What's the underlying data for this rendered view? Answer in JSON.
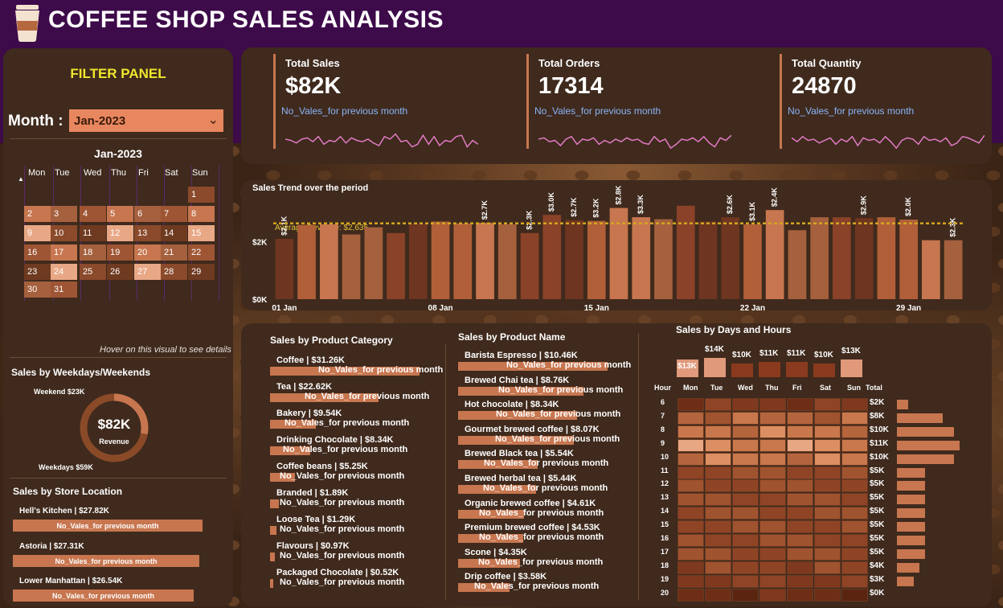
{
  "header": {
    "title": "COFFEE SHOP SALES ANALYSIS",
    "icon": "coffee-cup-icon"
  },
  "filter_panel": {
    "title": "FILTER PANEL",
    "month_label": "Month :",
    "month_value": "Jan-2023",
    "calendar": {
      "title": "Jan-2023",
      "weekdays": [
        "Mon",
        "Tue",
        "Wed",
        "Thu",
        "Fri",
        "Sat",
        "Sun"
      ],
      "weeks": [
        [
          "",
          "",
          "",
          "",
          "",
          "",
          "1"
        ],
        [
          "2",
          "3",
          "4",
          "5",
          "6",
          "7",
          "8"
        ],
        [
          "9",
          "10",
          "11",
          "12",
          "13",
          "14",
          "15"
        ],
        [
          "16",
          "17",
          "18",
          "19",
          "20",
          "21",
          "22"
        ],
        [
          "23",
          "24",
          "25",
          "26",
          "27",
          "28",
          "29"
        ],
        [
          "30",
          "31",
          "",
          "",
          "",
          "",
          ""
        ]
      ]
    },
    "hover_note": "Hover on this visual to see details"
  },
  "weekday_weekend": {
    "title": "Sales by Weekdays/Weekends",
    "weekend_label": "Weekend $23K",
    "weekdays_label": "Weekdays $59K",
    "center_value": "$82K",
    "center_caption": "Revenue",
    "weekend_share": 0.28
  },
  "store_location": {
    "title": "Sales by Store Location",
    "stores": [
      {
        "label": "Hell's Kitchen | $27.82K",
        "sub": "No_Vales_for previous month",
        "value": 27.82
      },
      {
        "label": "Astoria | $27.31K",
        "sub": "No_Vales_for previous month",
        "value": 27.31
      },
      {
        "label": "Lower Manhattan | $26.54K",
        "sub": "No_Vales_for previous month",
        "value": 26.54
      }
    ]
  },
  "kpis": [
    {
      "label": "Total Sales",
      "value": "$82K",
      "sub": "No_Vales_for previous month"
    },
    {
      "label": "Total Orders",
      "value": "17314",
      "sub": "No_Vales_for previous month"
    },
    {
      "label": "Total Quantity",
      "value": "24870",
      "sub": "No_Vales_for previous month"
    }
  ],
  "trend": {
    "title": "Sales Trend over the period",
    "avg_label": "Average Revenue: $2,635"
  },
  "product_category": {
    "title": "Sales by Product Category",
    "items": [
      {
        "label": "Coffee | $31.26K",
        "sub": "No_Vales_for previous month",
        "value": 31.26
      },
      {
        "label": "Tea | $22.62K",
        "sub": "No_Vales_for previous month",
        "value": 22.62
      },
      {
        "label": "Bakery | $9.54K",
        "sub": "No_Vales_for previous month",
        "value": 9.54
      },
      {
        "label": "Drinking Chocolate | $8.34K",
        "sub": "No_Vales_for previous month",
        "value": 8.34
      },
      {
        "label": "Coffee beans | $5.25K",
        "sub": "No_Vales_for previous month",
        "value": 5.25
      },
      {
        "label": "Branded | $1.89K",
        "sub": "No_Vales_for previous month",
        "value": 1.89
      },
      {
        "label": "Loose Tea | $1.29K",
        "sub": "No_Vales_for previous month",
        "value": 1.29
      },
      {
        "label": "Flavours | $0.97K",
        "sub": "No_Vales_for previous month",
        "value": 0.97
      },
      {
        "label": "Packaged Chocolate | $0.52K",
        "sub": "No_Vales_for previous month",
        "value": 0.52
      }
    ]
  },
  "product_name": {
    "title": "Sales by Product Name",
    "items": [
      {
        "label": "Barista Espresso | $10.46K",
        "sub": "No_Vales_for previous month",
        "value": 10.46
      },
      {
        "label": "Brewed Chai tea | $8.76K",
        "sub": "No_Vales_for previous month",
        "value": 8.76
      },
      {
        "label": "Hot chocolate | $8.34K",
        "sub": "No_Vales_for previous month",
        "value": 8.34
      },
      {
        "label": "Gourmet brewed coffee | $8.07K",
        "sub": "No_Vales_for previous month",
        "value": 8.07
      },
      {
        "label": "Brewed Black tea | $5.54K",
        "sub": "No_Vales_for previous month",
        "value": 5.54
      },
      {
        "label": "Brewed herbal tea | $5.44K",
        "sub": "No_Vales_for previous month",
        "value": 5.44
      },
      {
        "label": "Organic brewed coffee | $4.61K",
        "sub": "No_Vales_for previous month",
        "value": 4.61
      },
      {
        "label": "Premium brewed coffee | $4.53K",
        "sub": "No_Vales_for previous month",
        "value": 4.53
      },
      {
        "label": "Scone | $4.35K",
        "sub": "No_Vales_for previous month",
        "value": 4.35
      },
      {
        "label": "Drip coffee | $3.58K",
        "sub": "No_Vales_for previous month",
        "value": 3.58
      }
    ]
  },
  "heatmap": {
    "title": "Sales by Days and Hours",
    "hour_header": "Hour",
    "total_header": "Total",
    "days": [
      "Mon",
      "Tue",
      "Wed",
      "Thu",
      "Fri",
      "Sat",
      "Sun"
    ],
    "day_totals": [
      "$13K",
      "$14K",
      "$10K",
      "$11K",
      "$11K",
      "$10K",
      "$13K"
    ],
    "hours": [
      "6",
      "7",
      "8",
      "9",
      "10",
      "11",
      "12",
      "13",
      "14",
      "15",
      "16",
      "17",
      "18",
      "19",
      "20"
    ],
    "hour_totals": [
      "$2K",
      "$8K",
      "$10K",
      "$11K",
      "$10K",
      "$5K",
      "$5K",
      "$5K",
      "$5K",
      "$5K",
      "$5K",
      "$5K",
      "$4K",
      "$3K",
      "$0K"
    ]
  },
  "chart_data": [
    {
      "type": "bar",
      "title": "Sales Trend over the period",
      "x_tick_labels": [
        "01 Jan",
        "08 Jan",
        "15 Jan",
        "22 Jan",
        "29 Jan"
      ],
      "y_tick_labels": [
        "$0K",
        "$2K"
      ],
      "ylim": [
        0,
        3300
      ],
      "categories": [
        "1",
        "2",
        "3",
        "4",
        "5",
        "6",
        "7",
        "8",
        "9",
        "10",
        "11",
        "12",
        "13",
        "14",
        "15",
        "16",
        "17",
        "18",
        "19",
        "20",
        "21",
        "22",
        "23",
        "24",
        "25",
        "26",
        "27",
        "28",
        "29",
        "30",
        "31"
      ],
      "values": [
        2100,
        2580,
        2600,
        2250,
        2500,
        2300,
        2630,
        2700,
        2630,
        2650,
        2600,
        2300,
        2930,
        2750,
        2720,
        3170,
        2850,
        2780,
        3250,
        2700,
        2850,
        2600,
        3100,
        2400,
        2850,
        2850,
        2820,
        2850,
        2770,
        2050,
        2050,
        2550,
        2300
      ],
      "data_labels": [
        "$2.1K",
        "",
        "",
        "",
        "",
        "",
        "",
        "",
        "",
        "$2.7K",
        "",
        "$2.3K",
        "$3.0K",
        "$2.7K",
        "$3.2K",
        "$2.8K",
        "$3.3K",
        "",
        "",
        "",
        "$2.6K",
        "$3.1K",
        "$2.4K",
        "",
        "",
        "",
        "$2.9K",
        "",
        "$2.0K",
        "",
        "$2.3K"
      ],
      "average_line": 2635,
      "grid": false
    },
    {
      "type": "bar",
      "title": "Sales by Product Category",
      "categories": [
        "Coffee",
        "Tea",
        "Bakery",
        "Drinking Chocolate",
        "Coffee beans",
        "Branded",
        "Loose Tea",
        "Flavours",
        "Packaged Chocolate"
      ],
      "values": [
        31.26,
        22.62,
        9.54,
        8.34,
        5.25,
        1.89,
        1.29,
        0.97,
        0.52
      ]
    },
    {
      "type": "bar",
      "title": "Sales by Product Name",
      "categories": [
        "Barista Espresso",
        "Brewed Chai tea",
        "Hot chocolate",
        "Gourmet brewed coffee",
        "Brewed Black tea",
        "Brewed herbal tea",
        "Organic brewed coffee",
        "Premium brewed coffee",
        "Scone",
        "Drip coffee"
      ],
      "values": [
        10.46,
        8.76,
        8.34,
        8.07,
        5.54,
        5.44,
        4.61,
        4.53,
        4.35,
        3.58
      ]
    },
    {
      "type": "heatmap",
      "title": "Sales by Days and Hours",
      "x": [
        "Mon",
        "Tue",
        "Wed",
        "Thu",
        "Fri",
        "Sat",
        "Sun"
      ],
      "y": [
        "6",
        "7",
        "8",
        "9",
        "10",
        "11",
        "12",
        "13",
        "14",
        "15",
        "16",
        "17",
        "18",
        "19",
        "20"
      ],
      "day_totals_k": [
        13,
        14,
        10,
        11,
        11,
        10,
        13
      ],
      "hour_totals_k": [
        2,
        8,
        10,
        11,
        10,
        5,
        5,
        5,
        5,
        5,
        5,
        5,
        4,
        3,
        0
      ]
    },
    {
      "type": "pie",
      "title": "Sales by Weekdays/Weekends",
      "categories": [
        "Weekend",
        "Weekdays"
      ],
      "values": [
        23,
        59
      ]
    }
  ],
  "colors": {
    "header_bg": "#3d0a4a",
    "panel_bg": "#3f2a1d",
    "accent": "#c7764f",
    "filter_title": "#f0e62d",
    "sub_text": "#8ab4f8",
    "sparkline": "#e27ac4",
    "avg_line": "#d4a520"
  }
}
